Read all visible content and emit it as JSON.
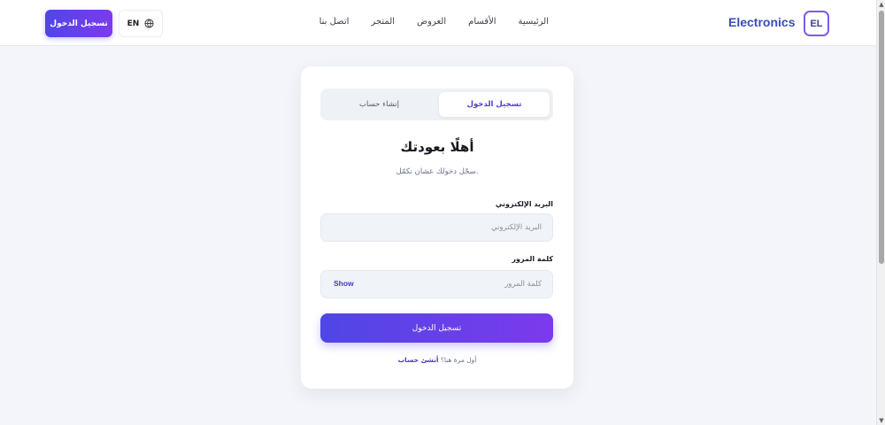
{
  "header": {
    "login_button": "تسجيل الدخول",
    "language": "EN",
    "nav": [
      "الرئيسية",
      "الأقسام",
      "العروض",
      "المتجر",
      "اتصل بنا"
    ],
    "brand_name": "Electronics",
    "brand_logo": "EL"
  },
  "auth": {
    "tabs": {
      "login": "تسجيل الدخول",
      "register": "إنشاء حساب"
    },
    "title": "أهلًا بعودتك",
    "subtitle": "سجّل دخولك عشان نكمّل.",
    "email": {
      "label": "البريد الإلكتروني",
      "placeholder": "البريد الإلكتروني"
    },
    "password": {
      "label": "كلمة المرور",
      "placeholder": "كلمة المرور",
      "show": "Show"
    },
    "submit": "تسجيل الدخول",
    "footer": {
      "prompt": "أول مرة هنا؟",
      "link": "أنشئ حساب"
    }
  },
  "icons": {
    "globe": "globe-icon"
  },
  "colors": {
    "accent_start": "#4f46e5",
    "accent_end": "#7c3aed",
    "brand_text": "#3b4db8"
  }
}
